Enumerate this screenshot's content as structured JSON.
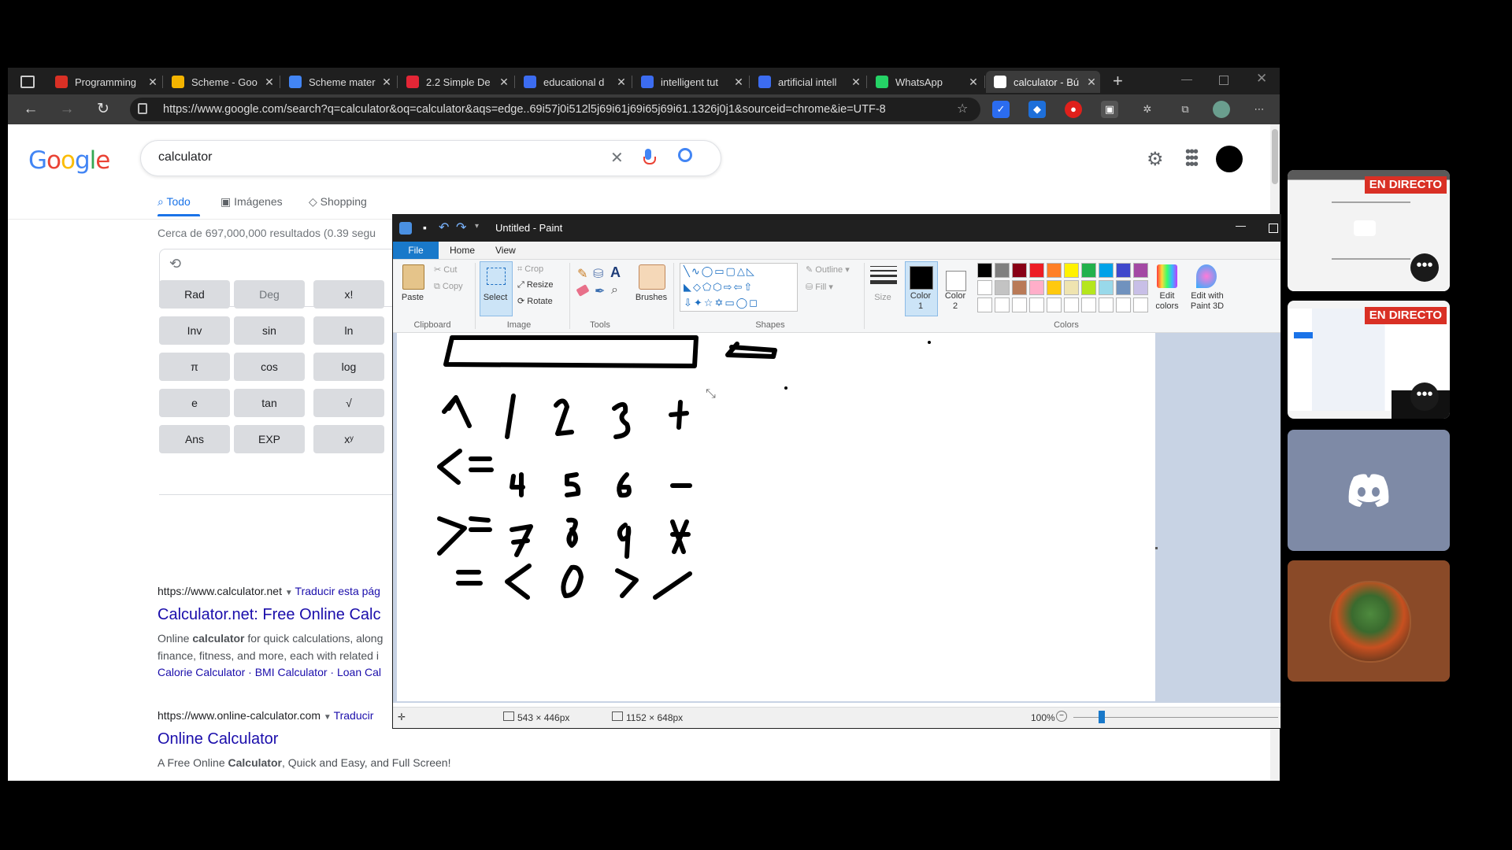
{
  "browser": {
    "tabs": [
      {
        "title": "Programming",
        "icon": "programming-favicon",
        "color": "#d93025"
      },
      {
        "title": "Scheme - Goo",
        "icon": "google-drive-favicon",
        "color": "#f4b400"
      },
      {
        "title": "Scheme mater",
        "icon": "google-docs-favicon",
        "color": "#4285f4"
      },
      {
        "title": "2.2 Simple De",
        "icon": "adobe-pdf-favicon",
        "color": "#e32636"
      },
      {
        "title": "educational d",
        "icon": "educational-favicon",
        "color": "#3c6cf0"
      },
      {
        "title": "intelligent tut",
        "icon": "intelligent-favicon",
        "color": "#3c6cf0"
      },
      {
        "title": "artificial intell",
        "icon": "artificial-favicon",
        "color": "#3c6cf0"
      },
      {
        "title": "WhatsApp",
        "icon": "whatsapp-favicon",
        "color": "#25d366"
      },
      {
        "title": "calculator - Bú",
        "icon": "google-favicon",
        "color": "#ffffff"
      }
    ],
    "url": "https://www.google.com/search?q=calculator&oq=calculator&aqs=edge..69i57j0i512l5j69i61j69i65j69i61.1326j0j1&sourceid=chrome&ie=UTF-8"
  },
  "google": {
    "logo": "Google",
    "query": "calculator",
    "nav": [
      "Todo",
      "Imágenes",
      "Shopping"
    ],
    "result_stats": "Cerca de 697,000,000 resultados (0.39 segu",
    "calc_keys": [
      [
        "Rad",
        "Deg",
        "x!"
      ],
      [
        "Inv",
        "sin",
        "ln"
      ],
      [
        "π",
        "cos",
        "log"
      ],
      [
        "e",
        "tan",
        "√"
      ],
      [
        "Ans",
        "EXP",
        "xʸ"
      ]
    ],
    "results": [
      {
        "url": "https://www.calculator.net",
        "translate": "Traducir esta pág",
        "title": "Calculator.net: Free Online Calc",
        "snippet1_pre": "Online ",
        "snippet1_bold": "calculator",
        "snippet1_post": " for quick calculations, along",
        "snippet2": "finance, fitness, and more, each with related i",
        "links": "Calorie Calculator · BMI Calculator · Loan Cal"
      },
      {
        "url": "https://www.online-calculator.com",
        "translate": "Traducir",
        "title": "Online Calculator",
        "snippet_pre": "A Free Online ",
        "snippet_bold": "Calculator",
        "snippet_post": ", Quick and Easy, and Full Screen!"
      }
    ]
  },
  "paint": {
    "title": "Untitled - Paint",
    "menu": [
      "File",
      "Home",
      "View"
    ],
    "clipboard": {
      "paste": "Paste",
      "cut": "Cut",
      "copy": "Copy",
      "label": "Clipboard"
    },
    "image": {
      "select": "Select",
      "crop": "Crop",
      "resize": "Resize",
      "rotate": "Rotate",
      "label": "Image"
    },
    "tools_label": "Tools",
    "brushes": "Brushes",
    "shapes": {
      "outline": "Outline",
      "fill": "Fill",
      "label": "Shapes"
    },
    "size": "Size",
    "color1": "Color\n1",
    "color2": "Color\n2",
    "colors_label": "Colors",
    "edit_colors": "Edit\ncolors",
    "edit_paint3d": "Edit with\nPaint 3D",
    "palette_row1": [
      "#000000",
      "#7f7f7f",
      "#880015",
      "#ed1c24",
      "#ff7f27",
      "#fff200",
      "#22b14c",
      "#00a2e8",
      "#3f48cc",
      "#a349a4"
    ],
    "palette_row2": [
      "#ffffff",
      "#c3c3c3",
      "#b97a57",
      "#ffaec9",
      "#ffc90e",
      "#efe4b0",
      "#b5e61d",
      "#99d9ea",
      "#7092be",
      "#c8bfe7"
    ],
    "status": {
      "selection": "543 × 446px",
      "canvas_size": "1152 × 648px",
      "zoom": "100%"
    }
  },
  "side_tiles": {
    "live_label": "EN DIRECTO",
    "more_label": "•••"
  }
}
